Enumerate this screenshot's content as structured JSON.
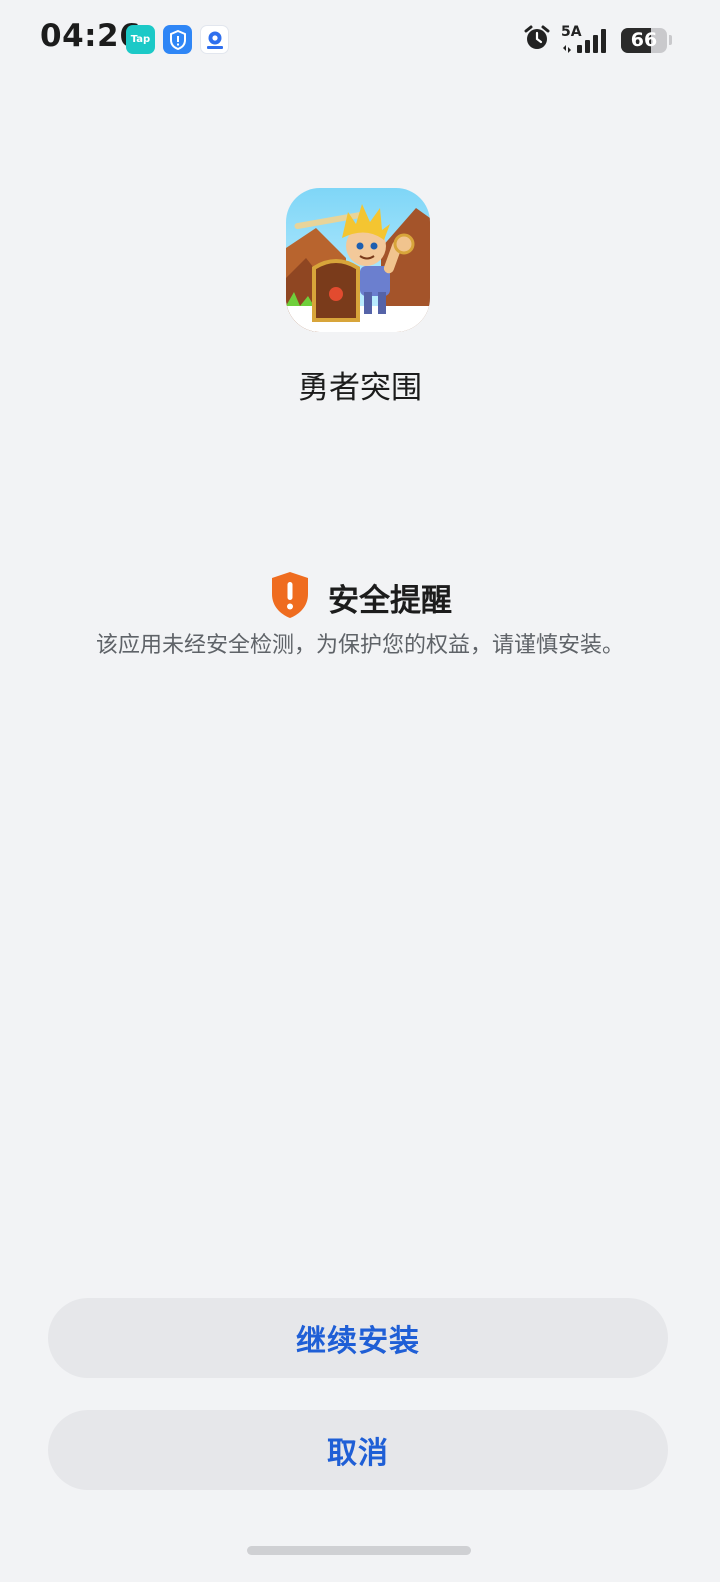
{
  "status_bar": {
    "time": "04:26",
    "notification_icons": [
      {
        "name": "tap-app-icon",
        "label": "Tap"
      },
      {
        "name": "shield-app-icon"
      },
      {
        "name": "map-app-icon"
      }
    ],
    "network": "5A",
    "battery_percent": 66,
    "battery_label": "66"
  },
  "app": {
    "name": "勇者突围",
    "icon": "game-hero-icon"
  },
  "security": {
    "title": "安全提醒",
    "description": "该应用未经安全检测，为保护您的权益，请谨慎安装。",
    "icon": "warning-shield-icon",
    "accent_color": "#ef6c1f"
  },
  "buttons": {
    "continue_label": "继续安装",
    "cancel_label": "取消",
    "text_color": "#1f5fd6"
  }
}
